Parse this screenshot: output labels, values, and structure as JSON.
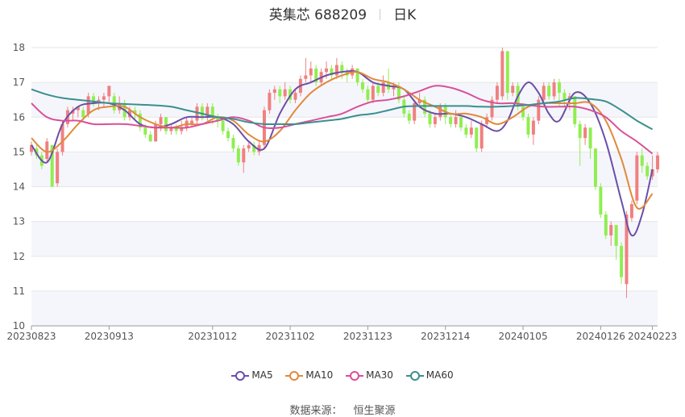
{
  "title": {
    "name": "英集芯 688209",
    "period": "日K"
  },
  "source": {
    "label": "数据来源：",
    "value": "恒生聚源"
  },
  "colors": {
    "up": "#f08080",
    "down": "#90ee50",
    "ma5": "#6a4fa8",
    "ma10": "#e08a3c",
    "ma30": "#d9509a",
    "ma60": "#3a8f8f",
    "band": "#f5f6fb",
    "grid": "#e6e6e6"
  },
  "chart_data": {
    "type": "candlestick",
    "ylim": [
      10,
      18
    ],
    "yticks": [
      10,
      11,
      12,
      13,
      14,
      15,
      16,
      17,
      18
    ],
    "grid": true,
    "legend_position": "bottom",
    "x_tick_labels": [
      {
        "i": 0,
        "label": "20230823"
      },
      {
        "i": 15,
        "label": "20230913"
      },
      {
        "i": 35,
        "label": "20231012"
      },
      {
        "i": 50,
        "label": "20231102"
      },
      {
        "i": 65,
        "label": "20231123"
      },
      {
        "i": 80,
        "label": "20231214"
      },
      {
        "i": 95,
        "label": "20240105"
      },
      {
        "i": 110,
        "label": "20240126"
      },
      {
        "i": 120,
        "label": "20240223"
      }
    ],
    "candles": [
      {
        "o": 15.0,
        "c": 15.2,
        "h": 15.3,
        "l": 14.9
      },
      {
        "o": 15.1,
        "c": 14.9,
        "h": 15.2,
        "l": 14.8
      },
      {
        "o": 14.9,
        "c": 14.6,
        "h": 15.0,
        "l": 14.5
      },
      {
        "o": 14.8,
        "c": 15.3,
        "h": 15.4,
        "l": 14.7
      },
      {
        "o": 15.2,
        "c": 14.0,
        "h": 15.2,
        "l": 14.0
      },
      {
        "o": 14.1,
        "c": 15.0,
        "h": 15.1,
        "l": 14.0
      },
      {
        "o": 15.0,
        "c": 15.8,
        "h": 15.9,
        "l": 14.9
      },
      {
        "o": 15.8,
        "c": 16.2,
        "h": 16.3,
        "l": 15.7
      },
      {
        "o": 16.1,
        "c": 16.2,
        "h": 16.3,
        "l": 15.9
      },
      {
        "o": 16.2,
        "c": 16.3,
        "h": 16.3,
        "l": 16.0
      },
      {
        "o": 16.2,
        "c": 16.0,
        "h": 16.3,
        "l": 15.9
      },
      {
        "o": 16.1,
        "c": 16.6,
        "h": 16.7,
        "l": 16.0
      },
      {
        "o": 16.6,
        "c": 16.4,
        "h": 16.7,
        "l": 16.3
      },
      {
        "o": 16.4,
        "c": 16.5,
        "h": 16.6,
        "l": 16.2
      },
      {
        "o": 16.5,
        "c": 16.6,
        "h": 16.7,
        "l": 16.3
      },
      {
        "o": 16.6,
        "c": 16.9,
        "h": 16.9,
        "l": 16.4
      },
      {
        "o": 16.6,
        "c": 16.2,
        "h": 16.7,
        "l": 16.1
      },
      {
        "o": 16.2,
        "c": 16.4,
        "h": 16.6,
        "l": 16.1
      },
      {
        "o": 16.4,
        "c": 16.0,
        "h": 16.5,
        "l": 15.9
      },
      {
        "o": 16.0,
        "c": 16.2,
        "h": 16.3,
        "l": 15.9
      },
      {
        "o": 16.2,
        "c": 16.1,
        "h": 16.3,
        "l": 15.9
      },
      {
        "o": 16.1,
        "c": 15.7,
        "h": 16.2,
        "l": 15.6
      },
      {
        "o": 15.7,
        "c": 15.5,
        "h": 15.8,
        "l": 15.4
      },
      {
        "o": 15.5,
        "c": 15.3,
        "h": 15.6,
        "l": 15.3
      },
      {
        "o": 15.3,
        "c": 15.8,
        "h": 15.9,
        "l": 15.3
      },
      {
        "o": 15.8,
        "c": 16.0,
        "h": 16.1,
        "l": 15.6
      },
      {
        "o": 16.0,
        "c": 15.6,
        "h": 16.0,
        "l": 15.5
      },
      {
        "o": 15.6,
        "c": 15.7,
        "h": 15.8,
        "l": 15.5
      },
      {
        "o": 15.7,
        "c": 15.6,
        "h": 15.8,
        "l": 15.5
      },
      {
        "o": 15.6,
        "c": 15.7,
        "h": 15.9,
        "l": 15.5
      },
      {
        "o": 15.7,
        "c": 15.9,
        "h": 16.0,
        "l": 15.6
      },
      {
        "o": 15.8,
        "c": 15.9,
        "h": 16.0,
        "l": 15.7
      },
      {
        "o": 15.9,
        "c": 16.3,
        "h": 16.4,
        "l": 15.8
      },
      {
        "o": 16.3,
        "c": 16.0,
        "h": 16.4,
        "l": 15.9
      },
      {
        "o": 16.0,
        "c": 16.3,
        "h": 16.4,
        "l": 15.9
      },
      {
        "o": 16.3,
        "c": 16.0,
        "h": 16.4,
        "l": 15.8
      },
      {
        "o": 16.0,
        "c": 15.9,
        "h": 16.1,
        "l": 15.7
      },
      {
        "o": 15.9,
        "c": 15.6,
        "h": 16.0,
        "l": 15.5
      },
      {
        "o": 15.6,
        "c": 15.4,
        "h": 15.7,
        "l": 15.3
      },
      {
        "o": 15.4,
        "c": 15.1,
        "h": 15.5,
        "l": 15.0
      },
      {
        "o": 15.1,
        "c": 14.7,
        "h": 15.2,
        "l": 14.6
      },
      {
        "o": 14.7,
        "c": 15.1,
        "h": 15.2,
        "l": 14.4
      },
      {
        "o": 15.1,
        "c": 15.2,
        "h": 15.3,
        "l": 15.0
      },
      {
        "o": 15.2,
        "c": 15.0,
        "h": 15.3,
        "l": 14.9
      },
      {
        "o": 15.0,
        "c": 15.2,
        "h": 15.3,
        "l": 14.9
      },
      {
        "o": 15.2,
        "c": 16.2,
        "h": 16.3,
        "l": 15.1
      },
      {
        "o": 16.2,
        "c": 16.7,
        "h": 16.8,
        "l": 16.1
      },
      {
        "o": 16.7,
        "c": 16.8,
        "h": 16.9,
        "l": 16.5
      },
      {
        "o": 16.8,
        "c": 16.6,
        "h": 16.9,
        "l": 16.4
      },
      {
        "o": 16.6,
        "c": 16.8,
        "h": 17.0,
        "l": 16.5
      },
      {
        "o": 16.8,
        "c": 16.5,
        "h": 16.9,
        "l": 16.4
      },
      {
        "o": 16.5,
        "c": 16.7,
        "h": 16.8,
        "l": 16.4
      },
      {
        "o": 16.7,
        "c": 17.1,
        "h": 17.2,
        "l": 16.6
      },
      {
        "o": 17.1,
        "c": 17.2,
        "h": 17.7,
        "l": 17.0
      },
      {
        "o": 17.2,
        "c": 17.4,
        "h": 17.6,
        "l": 17.0
      },
      {
        "o": 17.4,
        "c": 17.0,
        "h": 17.5,
        "l": 16.9
      },
      {
        "o": 17.0,
        "c": 17.3,
        "h": 17.4,
        "l": 16.9
      },
      {
        "o": 17.3,
        "c": 17.4,
        "h": 17.6,
        "l": 17.1
      },
      {
        "o": 17.4,
        "c": 17.2,
        "h": 17.5,
        "l": 17.1
      },
      {
        "o": 17.2,
        "c": 17.5,
        "h": 17.7,
        "l": 17.1
      },
      {
        "o": 17.5,
        "c": 17.3,
        "h": 17.6,
        "l": 17.1
      },
      {
        "o": 17.3,
        "c": 17.2,
        "h": 17.4,
        "l": 17.0
      },
      {
        "o": 17.2,
        "c": 17.4,
        "h": 17.5,
        "l": 17.1
      },
      {
        "o": 17.4,
        "c": 17.0,
        "h": 17.4,
        "l": 16.9
      },
      {
        "o": 17.0,
        "c": 16.8,
        "h": 17.1,
        "l": 16.7
      },
      {
        "o": 16.8,
        "c": 16.5,
        "h": 16.9,
        "l": 16.4
      },
      {
        "o": 16.5,
        "c": 16.9,
        "h": 17.0,
        "l": 16.4
      },
      {
        "o": 16.9,
        "c": 16.7,
        "h": 17.0,
        "l": 16.6
      },
      {
        "o": 16.7,
        "c": 17.0,
        "h": 17.2,
        "l": 16.6
      },
      {
        "o": 17.0,
        "c": 16.8,
        "h": 17.4,
        "l": 16.7
      },
      {
        "o": 16.8,
        "c": 16.9,
        "h": 17.0,
        "l": 16.6
      },
      {
        "o": 16.9,
        "c": 16.5,
        "h": 17.0,
        "l": 16.4
      },
      {
        "o": 16.5,
        "c": 16.1,
        "h": 16.6,
        "l": 16.0
      },
      {
        "o": 16.1,
        "c": 15.9,
        "h": 16.2,
        "l": 15.8
      },
      {
        "o": 15.9,
        "c": 16.4,
        "h": 16.5,
        "l": 15.8
      },
      {
        "o": 16.4,
        "c": 16.5,
        "h": 16.7,
        "l": 16.3
      },
      {
        "o": 16.5,
        "c": 16.1,
        "h": 16.6,
        "l": 16.0
      },
      {
        "o": 16.1,
        "c": 15.8,
        "h": 16.2,
        "l": 15.7
      },
      {
        "o": 15.8,
        "c": 16.0,
        "h": 16.1,
        "l": 15.7
      },
      {
        "o": 16.0,
        "c": 16.3,
        "h": 16.4,
        "l": 15.9
      },
      {
        "o": 16.3,
        "c": 16.0,
        "h": 16.4,
        "l": 15.8
      },
      {
        "o": 16.0,
        "c": 15.8,
        "h": 16.1,
        "l": 15.7
      },
      {
        "o": 15.8,
        "c": 16.0,
        "h": 16.2,
        "l": 15.7
      },
      {
        "o": 16.0,
        "c": 15.7,
        "h": 16.0,
        "l": 15.6
      },
      {
        "o": 15.7,
        "c": 15.5,
        "h": 15.8,
        "l": 15.4
      },
      {
        "o": 15.5,
        "c": 15.7,
        "h": 15.9,
        "l": 15.4
      },
      {
        "o": 15.7,
        "c": 15.1,
        "h": 15.7,
        "l": 15.0
      },
      {
        "o": 15.1,
        "c": 15.8,
        "h": 15.9,
        "l": 15.0
      },
      {
        "o": 15.8,
        "c": 16.0,
        "h": 16.1,
        "l": 15.7
      },
      {
        "o": 16.0,
        "c": 16.5,
        "h": 16.6,
        "l": 15.9
      },
      {
        "o": 16.5,
        "c": 16.9,
        "h": 17.0,
        "l": 16.4
      },
      {
        "o": 16.6,
        "c": 17.9,
        "h": 18.0,
        "l": 16.5
      },
      {
        "o": 17.9,
        "c": 16.7,
        "h": 17.9,
        "l": 16.5
      },
      {
        "o": 16.7,
        "c": 16.9,
        "h": 17.0,
        "l": 16.6
      },
      {
        "o": 16.9,
        "c": 16.3,
        "h": 17.0,
        "l": 16.2
      },
      {
        "o": 16.3,
        "c": 16.0,
        "h": 16.4,
        "l": 15.9
      },
      {
        "o": 16.0,
        "c": 15.5,
        "h": 16.1,
        "l": 15.4
      },
      {
        "o": 15.5,
        "c": 15.9,
        "h": 16.0,
        "l": 15.2
      },
      {
        "o": 15.9,
        "c": 16.5,
        "h": 16.6,
        "l": 15.8
      },
      {
        "o": 16.5,
        "c": 16.9,
        "h": 17.0,
        "l": 16.4
      },
      {
        "o": 16.9,
        "c": 16.6,
        "h": 17.0,
        "l": 16.5
      },
      {
        "o": 16.6,
        "c": 17.0,
        "h": 17.1,
        "l": 16.5
      },
      {
        "o": 17.0,
        "c": 16.7,
        "h": 17.1,
        "l": 16.3
      },
      {
        "o": 16.7,
        "c": 16.5,
        "h": 16.8,
        "l": 16.3
      },
      {
        "o": 16.5,
        "c": 16.6,
        "h": 16.7,
        "l": 16.2
      },
      {
        "o": 16.6,
        "c": 15.8,
        "h": 16.6,
        "l": 15.7
      },
      {
        "o": 15.8,
        "c": 15.4,
        "h": 15.9,
        "l": 14.6
      },
      {
        "o": 15.4,
        "c": 15.7,
        "h": 15.8,
        "l": 15.2
      },
      {
        "o": 15.7,
        "c": 15.1,
        "h": 15.7,
        "l": 14.8
      },
      {
        "o": 15.1,
        "c": 14.0,
        "h": 15.1,
        "l": 13.9
      },
      {
        "o": 14.0,
        "c": 13.2,
        "h": 14.1,
        "l": 13.1
      },
      {
        "o": 13.2,
        "c": 12.6,
        "h": 13.3,
        "l": 12.5
      },
      {
        "o": 12.6,
        "c": 12.9,
        "h": 13.0,
        "l": 12.3
      },
      {
        "o": 12.9,
        "c": 12.3,
        "h": 12.9,
        "l": 11.9
      },
      {
        "o": 12.3,
        "c": 11.4,
        "h": 12.4,
        "l": 11.2
      },
      {
        "o": 11.2,
        "c": 13.2,
        "h": 13.3,
        "l": 10.8
      },
      {
        "o": 13.1,
        "c": 13.5,
        "h": 13.6,
        "l": 13.0
      },
      {
        "o": 13.6,
        "c": 14.9,
        "h": 15.0,
        "l": 13.5
      },
      {
        "o": 14.9,
        "c": 14.6,
        "h": 15.1,
        "l": 14.4
      },
      {
        "o": 14.6,
        "c": 14.3,
        "h": 14.7,
        "l": 14.2
      },
      {
        "o": 14.3,
        "c": 14.5,
        "h": 14.9,
        "l": 14.2
      },
      {
        "o": 14.5,
        "c": 14.9,
        "h": 15.0,
        "l": 14.4
      }
    ],
    "series": [
      {
        "name": "MA5",
        "x": [
          0,
          3,
          6,
          9,
          12,
          15,
          18,
          21,
          24,
          27,
          30,
          33,
          36,
          39,
          42,
          45,
          48,
          51,
          54,
          57,
          60,
          63,
          66,
          69,
          72,
          75,
          78,
          81,
          84,
          87,
          90,
          92,
          94,
          96,
          98,
          100,
          102,
          105,
          108,
          111,
          114,
          116,
          118,
          120
        ],
        "y": [
          15.2,
          14.7,
          15.8,
          16.3,
          16.4,
          16.4,
          16.2,
          15.8,
          15.7,
          15.8,
          16.0,
          16.0,
          16.0,
          15.8,
          15.3,
          15.1,
          16.1,
          16.8,
          17.0,
          17.2,
          17.3,
          17.3,
          17.0,
          16.9,
          16.8,
          16.3,
          16.1,
          16.1,
          16.0,
          15.8,
          15.6,
          15.9,
          16.6,
          17.0,
          16.7,
          16.1,
          15.9,
          16.7,
          16.4,
          15.3,
          13.6,
          12.6,
          13.2,
          14.5
        ]
      },
      {
        "name": "MA10",
        "x": [
          0,
          3,
          6,
          9,
          12,
          15,
          18,
          21,
          24,
          27,
          30,
          33,
          36,
          39,
          42,
          45,
          48,
          51,
          54,
          57,
          60,
          63,
          66,
          69,
          72,
          75,
          78,
          81,
          84,
          87,
          90,
          93,
          96,
          99,
          102,
          105,
          108,
          111,
          114,
          117,
          120
        ],
        "y": [
          15.4,
          15.0,
          15.3,
          15.8,
          16.2,
          16.3,
          16.3,
          16.0,
          15.8,
          15.7,
          15.8,
          15.8,
          16.0,
          15.9,
          15.5,
          15.3,
          15.6,
          16.2,
          16.7,
          17.0,
          17.2,
          17.3,
          17.1,
          17.0,
          16.8,
          16.5,
          16.3,
          16.1,
          16.1,
          16.0,
          15.8,
          16.0,
          16.3,
          16.4,
          16.4,
          16.4,
          16.4,
          15.9,
          14.8,
          13.4,
          13.8
        ]
      },
      {
        "name": "MA30",
        "x": [
          0,
          3,
          6,
          9,
          12,
          15,
          18,
          21,
          24,
          27,
          30,
          33,
          36,
          39,
          42,
          45,
          48,
          51,
          54,
          57,
          60,
          63,
          66,
          69,
          72,
          75,
          78,
          81,
          84,
          87,
          90,
          93,
          96,
          99,
          102,
          105,
          108,
          111,
          114,
          117,
          120
        ],
        "y": [
          16.4,
          16.0,
          15.9,
          15.9,
          15.8,
          15.8,
          15.8,
          15.75,
          15.7,
          15.7,
          15.7,
          15.8,
          15.9,
          16.0,
          15.9,
          15.7,
          15.7,
          15.8,
          15.9,
          16.0,
          16.1,
          16.3,
          16.45,
          16.5,
          16.6,
          16.75,
          16.9,
          16.85,
          16.7,
          16.5,
          16.4,
          16.4,
          16.35,
          16.3,
          16.3,
          16.3,
          16.2,
          16.0,
          15.6,
          15.3,
          14.95
        ]
      },
      {
        "name": "MA60",
        "x": [
          0,
          3,
          6,
          9,
          12,
          15,
          18,
          21,
          24,
          27,
          30,
          33,
          36,
          39,
          42,
          45,
          48,
          51,
          54,
          57,
          60,
          63,
          66,
          69,
          72,
          75,
          78,
          81,
          84,
          87,
          90,
          93,
          96,
          99,
          102,
          105,
          108,
          111,
          114,
          117,
          120
        ],
        "y": [
          16.8,
          16.65,
          16.55,
          16.5,
          16.45,
          16.4,
          16.38,
          16.36,
          16.34,
          16.3,
          16.2,
          16.1,
          16.0,
          15.95,
          15.85,
          15.8,
          15.8,
          15.8,
          15.85,
          15.9,
          15.95,
          16.05,
          16.1,
          16.2,
          16.3,
          16.32,
          16.32,
          16.32,
          16.32,
          16.3,
          16.3,
          16.32,
          16.35,
          16.4,
          16.45,
          16.55,
          16.52,
          16.45,
          16.2,
          15.9,
          15.65
        ]
      }
    ]
  }
}
